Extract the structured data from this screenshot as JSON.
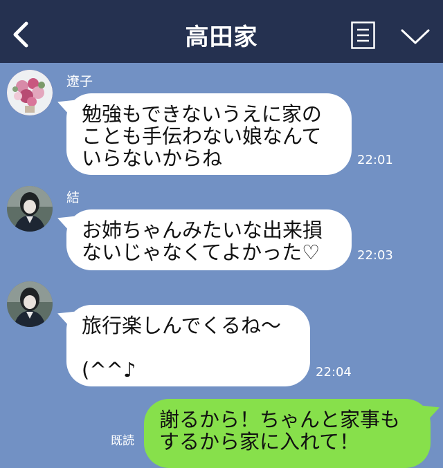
{
  "header": {
    "title": "高田家",
    "back_icon": "chevron-left-icon",
    "menu_icon": "menu-list-icon",
    "more_icon": "chevron-down-icon"
  },
  "colors": {
    "header_bg": "#253150",
    "chat_bg": "#7291c4",
    "bubble_in": "#ffffff",
    "bubble_out": "#87e04b"
  },
  "messages": [
    {
      "sender": "遼子",
      "text": "勉強もできないうえに家の\nことも手伝わない娘なんて\nいらないからね",
      "time": "22:01"
    },
    {
      "sender": "結",
      "text": "お姉ちゃんみたいな出来損\nないじゃなくてよかった♡",
      "time": "22:03"
    },
    {
      "sender": "",
      "text": "旅行楽しんでくるね〜\n\n(^^♪",
      "time": "22:04"
    }
  ],
  "outgoing": {
    "read_label": "既読",
    "text": "謝るから！ちゃんと家事も\nするから家に入れて！"
  }
}
